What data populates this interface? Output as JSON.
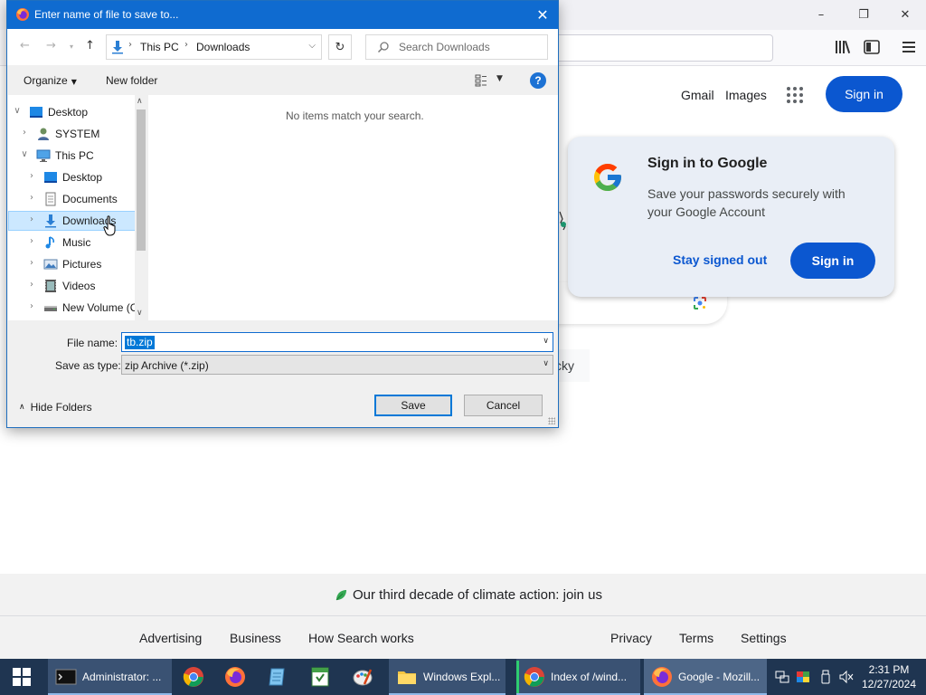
{
  "dialog": {
    "title": "Enter name of file to save to...",
    "address": [
      "This PC",
      "Downloads"
    ],
    "search_placeholder": "Search Downloads",
    "toolbar": {
      "organize": "Organize",
      "new_folder": "New folder"
    },
    "help_label": "?",
    "tree": [
      {
        "label": "Desktop",
        "icon": "desktop-icon",
        "expanded": true
      },
      {
        "label": "SYSTEM",
        "icon": "user-icon"
      },
      {
        "label": "This PC",
        "icon": "computer-icon",
        "expanded": true
      },
      {
        "label": "Desktop",
        "icon": "desktop-icon"
      },
      {
        "label": "Documents",
        "icon": "documents-icon"
      },
      {
        "label": "Downloads",
        "icon": "downloads-icon",
        "selected": true
      },
      {
        "label": "Music",
        "icon": "music-icon"
      },
      {
        "label": "Pictures",
        "icon": "pictures-icon"
      },
      {
        "label": "Videos",
        "icon": "videos-icon"
      },
      {
        "label": "New Volume (C",
        "icon": "drive-icon"
      }
    ],
    "empty_message": "No items match your search.",
    "file_name_label": "File name:",
    "file_name_value": "tb.zip",
    "save_type_label": "Save as type:",
    "save_type_value": "zip Archive (*.zip)",
    "hide_folders": "Hide Folders",
    "save_button": "Save",
    "cancel_button": "Cancel"
  },
  "google": {
    "gmail": "Gmail",
    "images": "Images",
    "sign_in": "Sign in",
    "lucky_fragment": "cky",
    "onetap": {
      "title": "Sign in to Google",
      "description": "Save your passwords securely with your Google Account",
      "stay_signed_out": "Stay signed out",
      "sign_in": "Sign in"
    },
    "footer": {
      "climate": "Our third decade of climate action: join us",
      "links_left": [
        "Advertising",
        "Business",
        "How Search works"
      ],
      "links_right": [
        "Privacy",
        "Terms",
        "Settings"
      ]
    }
  },
  "taskbar": {
    "buttons": [
      {
        "label": "Administrator: ...",
        "icon": "terminal-icon"
      },
      {
        "label": "Windows Expl...",
        "icon": "folder-icon"
      },
      {
        "label": "Index of /wind...",
        "icon": "chrome-icon"
      },
      {
        "label": "Google - Mozill...",
        "icon": "firefox-icon"
      }
    ],
    "pinned": [
      "chrome-icon",
      "firefox-icon",
      "notepad-icon",
      "spreadsheet-icon",
      "paint-icon"
    ],
    "time": "2:31 PM",
    "date": "12/27/2024"
  },
  "colors": {
    "dialog_titlebar": "#0f6bd0",
    "google_blue": "#0b57d0",
    "taskbar": "#1f3551",
    "selection": "#cce8ff"
  }
}
